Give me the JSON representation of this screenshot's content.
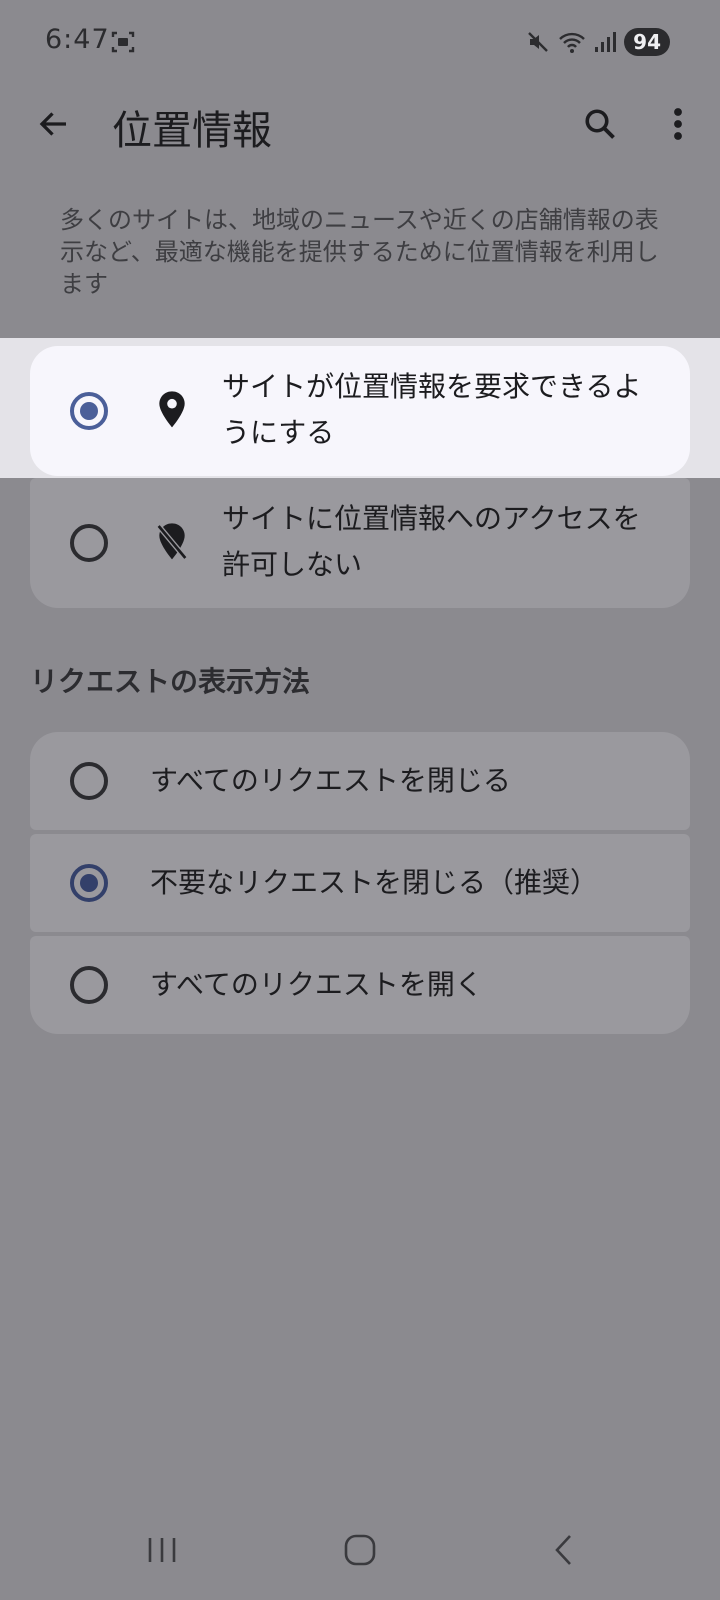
{
  "status_bar": {
    "time": "6:47",
    "battery": "94",
    "icons": [
      "screenshot-scan-icon",
      "mute-icon",
      "wifi-icon",
      "signal-icon"
    ]
  },
  "app_bar": {
    "title": "位置情報",
    "icons": [
      "back-arrow-icon",
      "search-icon",
      "more-vert-icon"
    ]
  },
  "description": "多くのサイトは、地域のニュースや近くの店舗情報の表示など、最適な機能を提供するために位置情報を利用します",
  "location_options": [
    {
      "label_line1": "サイトが位置情報を要求できるよ",
      "label_line2": "うにする",
      "selected": true,
      "icon": "location-pin-icon"
    },
    {
      "label_line1": "サイトに位置情報へのアクセスを",
      "label_line2": "許可しない",
      "selected": false,
      "icon": "location-off-icon"
    }
  ],
  "request_section": {
    "heading": "リクエストの表示方法",
    "options": [
      {
        "label": "すべてのリクエストを閉じる",
        "selected": false
      },
      {
        "label": "不要なリクエストを閉じる（推奨）",
        "selected": true
      },
      {
        "label": "すべてのリクエストを開く",
        "selected": false
      }
    ]
  },
  "nav_bar": {
    "icons": [
      "recent-apps-icon",
      "home-icon",
      "back-nav-icon"
    ]
  },
  "colors": {
    "overlay": "#8b8a8f",
    "accent": "#4b5f99",
    "selected_card": "#f7f6fc"
  }
}
